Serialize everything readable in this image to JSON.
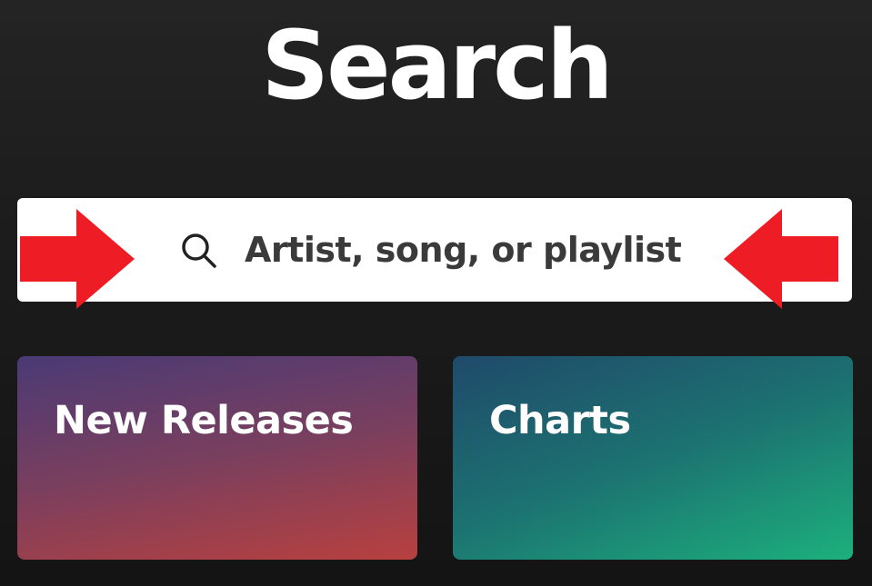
{
  "header": {
    "title": "Search"
  },
  "search": {
    "placeholder": "Artist, song, or playlist",
    "icon": "search-icon"
  },
  "annotations": {
    "arrow_color": "#ee1c24"
  },
  "cards": [
    {
      "label": "New Releases"
    },
    {
      "label": "Charts"
    }
  ],
  "colors": {
    "background": "#1c1c1c",
    "search_bg": "#ffffff",
    "placeholder_text": "#3a3a3a",
    "new_releases_from": "#4a3a75",
    "new_releases_to": "#b8403f",
    "charts_from": "#1f4a6a",
    "charts_to": "#1cb07c"
  }
}
